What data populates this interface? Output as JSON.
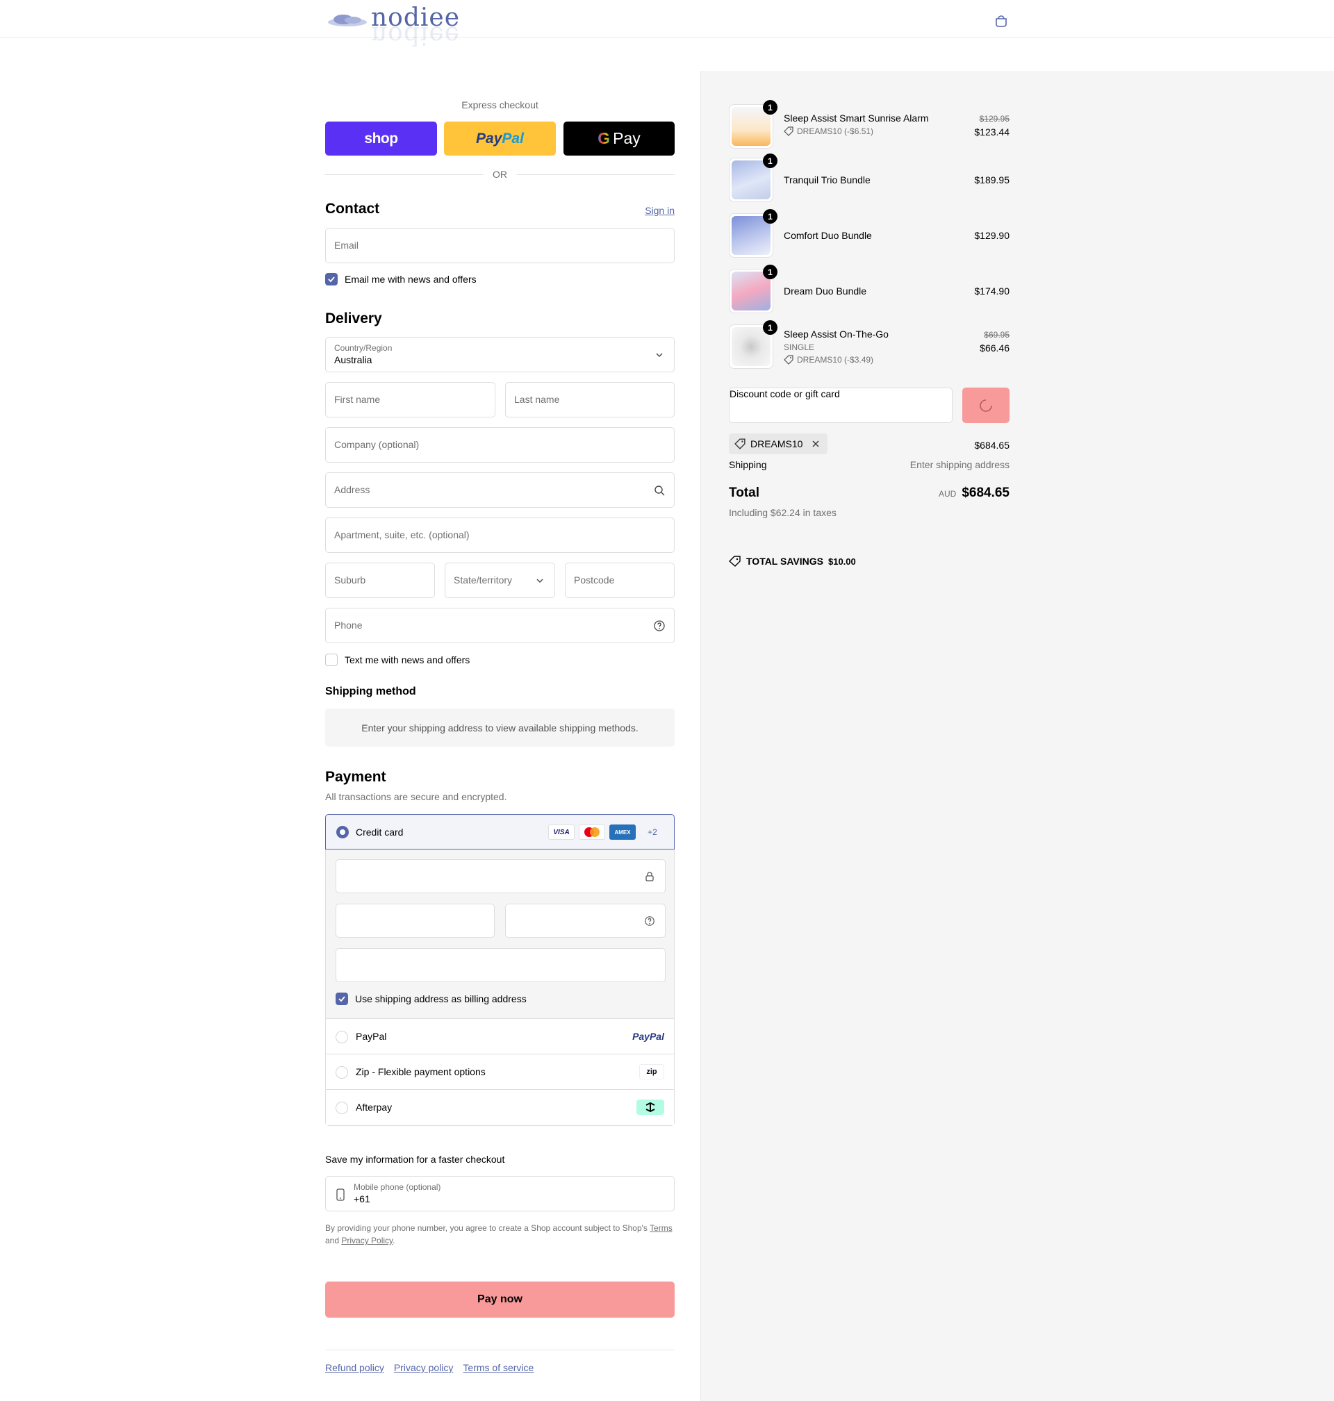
{
  "header": {
    "logo_text": "nodiee"
  },
  "express": {
    "label": "Express checkout",
    "shop_label": "shop",
    "paypal_label_a": "Pay",
    "paypal_label_b": "Pal",
    "gpay_label_g": "G",
    "gpay_label": "Pay",
    "or_label": "OR"
  },
  "contact": {
    "title": "Contact",
    "sign_in": "Sign in",
    "email_placeholder": "Email",
    "news_label": "Email me with news and offers",
    "news_checked": true
  },
  "delivery": {
    "title": "Delivery",
    "country_label": "Country/Region",
    "country_value": "Australia",
    "first_name": "First name",
    "last_name": "Last name",
    "company": "Company (optional)",
    "address": "Address",
    "apartment": "Apartment, suite, etc. (optional)",
    "suburb": "Suburb",
    "state": "State/territory",
    "postcode": "Postcode",
    "phone": "Phone",
    "text_label": "Text me with news and offers",
    "text_checked": false
  },
  "shipping_method": {
    "title": "Shipping method",
    "message": "Enter your shipping address to view available shipping methods."
  },
  "payment": {
    "title": "Payment",
    "subtitle": "All transactions are secure and encrypted.",
    "credit_card_label": "Credit card",
    "card_brands": [
      "VISA",
      "AMEX"
    ],
    "more_brands": "+2",
    "billing_label": "Use shipping address as billing address",
    "billing_checked": true,
    "options": [
      {
        "label": "PayPal",
        "logo": "PayPal"
      },
      {
        "label": "Zip - Flexible payment options",
        "logo": "zip"
      },
      {
        "label": "Afterpay",
        "logo": "afterpay"
      }
    ]
  },
  "save_info": {
    "title": "Save my information for a faster checkout",
    "mobile_label": "Mobile phone (optional)",
    "mobile_value": "+61",
    "legal_a": "By providing your phone number, you agree to create a Shop account subject to Shop's ",
    "legal_terms": "Terms",
    "legal_b": " and ",
    "legal_privacy": "Privacy Policy",
    "legal_c": "."
  },
  "pay_now": "Pay now",
  "footer": {
    "links": [
      "Refund policy",
      "Privacy policy",
      "Terms of service"
    ]
  },
  "summary": {
    "items": [
      {
        "name": "Sleep Assist Smart Sunrise Alarm",
        "qty": "1",
        "old_price": "$129.95",
        "price": "$123.44",
        "discount": "DREAMS10 (-$6.51)",
        "variant": ""
      },
      {
        "name": "Tranquil Trio Bundle",
        "qty": "1",
        "old_price": "",
        "price": "$189.95",
        "discount": "",
        "variant": ""
      },
      {
        "name": "Comfort Duo Bundle",
        "qty": "1",
        "old_price": "",
        "price": "$129.90",
        "discount": "",
        "variant": ""
      },
      {
        "name": "Dream Duo Bundle",
        "qty": "1",
        "old_price": "",
        "price": "$174.90",
        "discount": "",
        "variant": ""
      },
      {
        "name": "Sleep Assist On-The-Go",
        "qty": "1",
        "old_price": "$69.95",
        "price": "$66.46",
        "discount": "DREAMS10 (-$3.49)",
        "variant": "SINGLE"
      }
    ],
    "discount_placeholder": "Discount code or gift card",
    "applied_code": "DREAMS10",
    "subtotal": "$684.65",
    "shipping_label": "Shipping",
    "shipping_value": "Enter shipping address",
    "total_label": "Total",
    "currency": "AUD",
    "total_value": "$684.65",
    "taxes": "Including $62.24 in taxes",
    "savings_label": "TOTAL SAVINGS",
    "savings_value": "$10.00"
  },
  "colors": {
    "accent": "#5566a8",
    "pay_button": "#f89a9a",
    "shop_pay": "#5a31f4",
    "paypal": "#ffc439"
  }
}
